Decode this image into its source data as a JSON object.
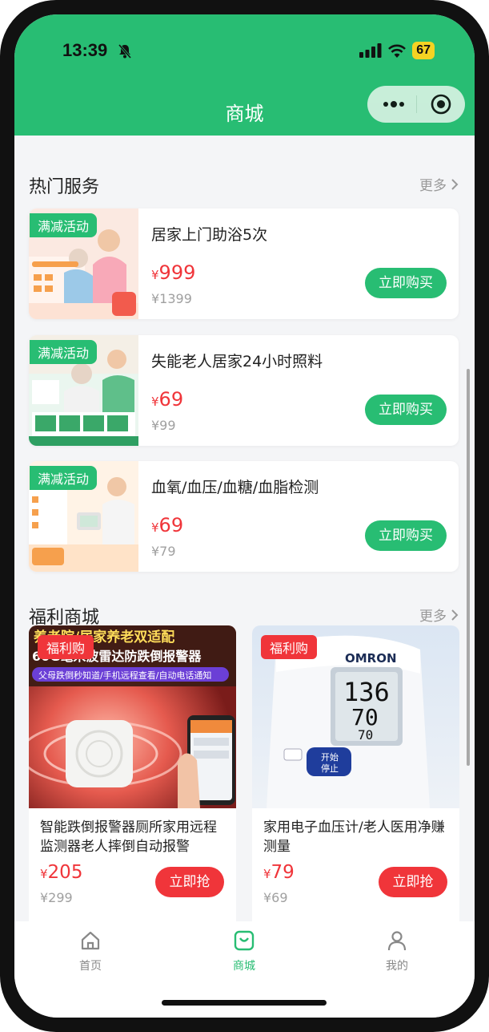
{
  "status_bar": {
    "time": "13:39",
    "battery": "67"
  },
  "header": {
    "title": "商城"
  },
  "hot_services": {
    "title": "热门服务",
    "more": "更多",
    "items": [
      {
        "tag": "满减活动",
        "name": "居家上门助浴5次",
        "currency": "¥",
        "price": "999",
        "original": "¥1399",
        "button": "立即购买"
      },
      {
        "tag": "满减活动",
        "name": "失能老人居家24小时照料",
        "currency": "¥",
        "price": "69",
        "original": "¥99",
        "button": "立即购买"
      },
      {
        "tag": "满减活动",
        "name": "血氧/血压/血糖/血脂检测",
        "currency": "¥",
        "price": "69",
        "original": "¥79",
        "button": "立即购买"
      }
    ]
  },
  "welfare_mall": {
    "title": "福利商城",
    "more": "更多",
    "products": [
      {
        "tag": "福利购",
        "name": "智能跌倒报警器厕所家用远程监测器老人摔倒自动报警",
        "currency": "¥",
        "price": "205",
        "original": "¥299",
        "button": "立即抢",
        "image_text": {
          "line1": "养老院/居家养老双适配",
          "line2": "60G毫米波雷达防跌倒报警器",
          "line3": "父母跌倒秒知道/手机远程查看/自动电话通知"
        }
      },
      {
        "tag": "福利购",
        "name": "家用电子血压计/老人医用净赚测量",
        "currency": "¥",
        "price": "79",
        "original": "¥69",
        "button": "立即抢",
        "image_text": {
          "brand": "OMRON",
          "reading1": "136",
          "reading2": "70",
          "reading3": "70",
          "btn1": "开始",
          "btn2": "停止"
        }
      }
    ]
  },
  "tabbar": {
    "tabs": [
      {
        "label": "首页",
        "icon": "home-icon"
      },
      {
        "label": "商城",
        "icon": "shopping-bag-icon",
        "active": true
      },
      {
        "label": "我的",
        "icon": "user-icon"
      }
    ]
  },
  "colors": {
    "brand": "#28bd73",
    "price": "#f0353a",
    "welfare_tag": "#f0353a"
  }
}
